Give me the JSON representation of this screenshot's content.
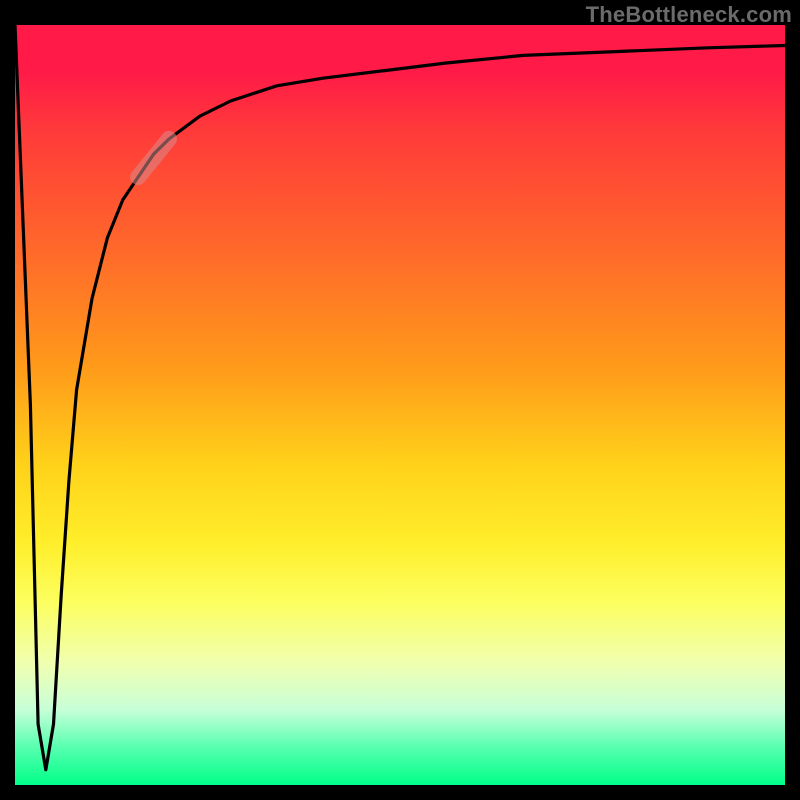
{
  "watermark": "TheBottleneck.com",
  "chart_data": {
    "type": "line",
    "title": "",
    "xlabel": "",
    "ylabel": "",
    "xlim": [
      0,
      100
    ],
    "ylim": [
      0,
      100
    ],
    "grid": false,
    "legend": false,
    "series": [
      {
        "name": "bottleneck-curve",
        "x": [
          0,
          2,
          3,
          4,
          5,
          6,
          7,
          8,
          10,
          12,
          14,
          16,
          18,
          20,
          24,
          28,
          34,
          40,
          48,
          56,
          66,
          78,
          90,
          100
        ],
        "y": [
          100,
          50,
          8,
          2,
          8,
          25,
          40,
          52,
          64,
          72,
          77,
          80,
          83,
          85,
          88,
          90,
          92,
          93,
          94,
          95,
          96,
          96.5,
          97,
          97.3
        ]
      }
    ],
    "annotations": [
      {
        "name": "highlight-band",
        "x_range": [
          16,
          20
        ],
        "note": "faded overlay on curve"
      }
    ],
    "background": {
      "type": "vertical-gradient",
      "stops": [
        {
          "pos": 0,
          "color": "#ff1a48"
        },
        {
          "pos": 30,
          "color": "#ff6a2a"
        },
        {
          "pos": 58,
          "color": "#ffd21a"
        },
        {
          "pos": 76,
          "color": "#fcff60"
        },
        {
          "pos": 90,
          "color": "#c8ffd8"
        },
        {
          "pos": 100,
          "color": "#00ff88"
        }
      ]
    }
  }
}
